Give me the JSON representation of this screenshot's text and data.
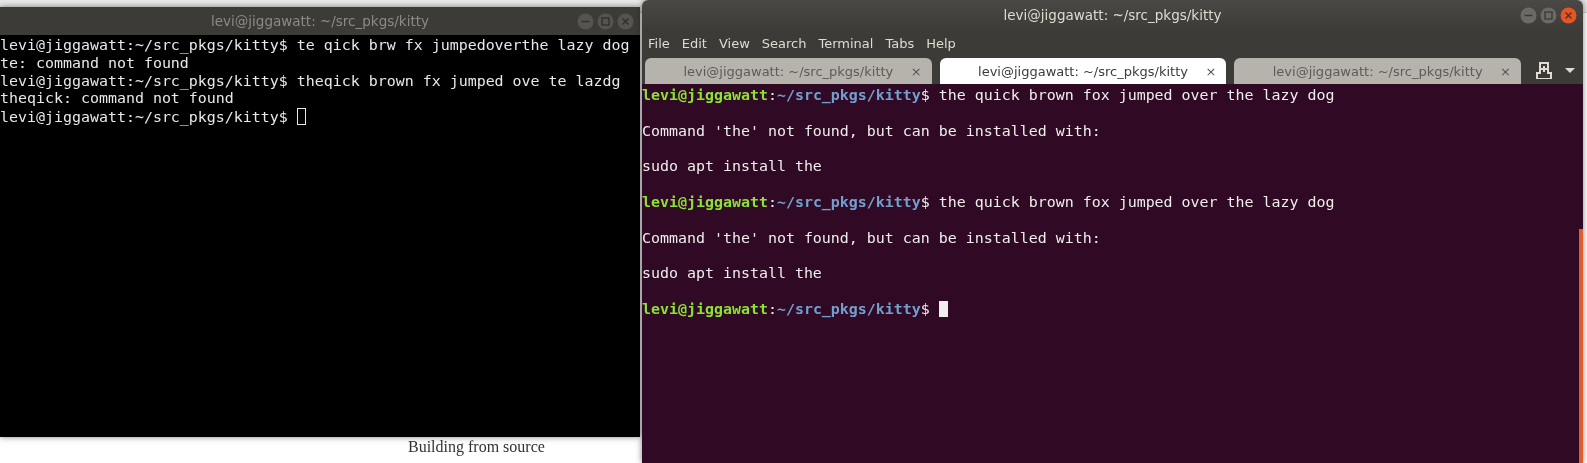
{
  "background_page": {
    "heading": "Building from source"
  },
  "windows": [
    {
      "title": "levi@jiggawatt: ~/src_pkgs/kitty",
      "focused": false,
      "colored_prompt": false,
      "kind": "black",
      "lines": [
        {
          "kind": "prompt",
          "user": "levi@jiggawatt",
          "sep": ":",
          "path": "~/src_pkgs/kitty",
          "symbol": "$",
          "command": " te qick brw fx jumpedoverthe lazy dog"
        },
        {
          "kind": "output",
          "text": "te: command not found"
        },
        {
          "kind": "prompt",
          "user": "levi@jiggawatt",
          "sep": ":",
          "path": "~/src_pkgs/kitty",
          "symbol": "$",
          "command": " theqick brown fx jumped ove te lazdg"
        },
        {
          "kind": "output",
          "text": "theqick: command not found"
        },
        {
          "kind": "prompt",
          "user": "levi@jiggawatt",
          "sep": ":",
          "path": "~/src_pkgs/kitty",
          "symbol": "$",
          "cursor": true
        }
      ]
    },
    {
      "title": "levi@jiggawatt: ~/src_pkgs/kitty",
      "focused": true,
      "colored_prompt": true,
      "kind": "aubergine",
      "menu": [
        "File",
        "Edit",
        "View",
        "Search",
        "Terminal",
        "Tabs",
        "Help"
      ],
      "tabs": [
        {
          "label": "levi@jiggawatt: ~/src_pkgs/kitty",
          "close": "×",
          "selected": false
        },
        {
          "label": "levi@jiggawatt: ~/src_pkgs/kitty",
          "close": "×",
          "selected": true
        },
        {
          "label": "levi@jiggawatt: ~/src_pkgs/kitty",
          "close": "×",
          "selected": false
        }
      ],
      "lines": [
        {
          "kind": "prompt",
          "user": "levi@jiggawatt",
          "sep": ":",
          "path": "~/src_pkgs/kitty",
          "symbol": "$",
          "command": " the quick brown fox jumped over the lazy dog"
        },
        {
          "kind": "blank"
        },
        {
          "kind": "output",
          "text": "Command 'the' not found, but can be installed with:"
        },
        {
          "kind": "blank"
        },
        {
          "kind": "output",
          "text": "sudo apt install the"
        },
        {
          "kind": "blank"
        },
        {
          "kind": "prompt",
          "user": "levi@jiggawatt",
          "sep": ":",
          "path": "~/src_pkgs/kitty",
          "symbol": "$",
          "command": " the quick brown fox jumped over the lazy dog"
        },
        {
          "kind": "blank"
        },
        {
          "kind": "output",
          "text": "Command 'the' not found, but can be installed with:"
        },
        {
          "kind": "blank"
        },
        {
          "kind": "output",
          "text": "sudo apt install the"
        },
        {
          "kind": "blank"
        },
        {
          "kind": "prompt",
          "user": "levi@jiggawatt",
          "sep": ":",
          "path": "~/src_pkgs/kitty",
          "symbol": "$",
          "cursor": true
        }
      ]
    }
  ]
}
